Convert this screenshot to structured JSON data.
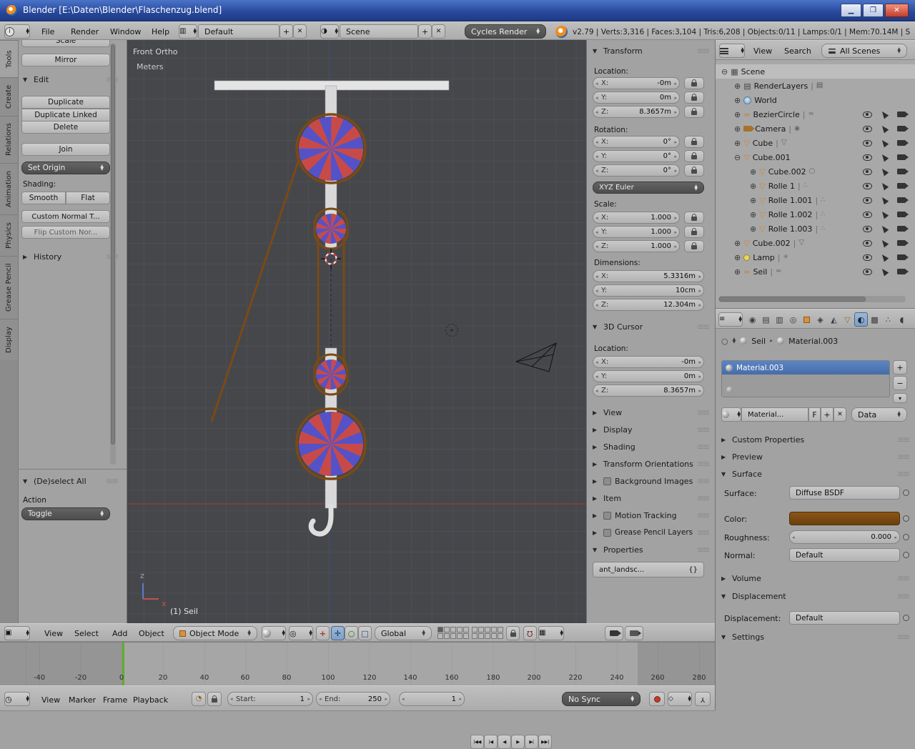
{
  "titlebar": {
    "title": "Blender [E:\\Daten\\Blender\\Flaschenzug.blend]"
  },
  "info": {
    "menus": [
      "File",
      "Render",
      "Window",
      "Help"
    ],
    "layout": "Default",
    "scene": "Scene",
    "engine": "Cycles Render",
    "stats": "v2.79 | Verts:3,316 | Faces:3,104 | Tris:6,208 | Objects:0/11 | Lamps:0/1 | Mem:70.14M | S"
  },
  "ui": {
    "plus": "+",
    "minus": "−",
    "close": "✕",
    "down": "▾"
  },
  "toolshelf": {
    "tabs": [
      "Tools",
      "Create",
      "Relations",
      "Animation",
      "Physics",
      "Grease Pencil",
      "Display"
    ],
    "scale": "Scale",
    "mirror": "Mirror",
    "edit": {
      "title": "Edit",
      "duplicate": "Duplicate",
      "duplicate_linked": "Duplicate Linked",
      "delete": "Delete",
      "join": "Join",
      "set_origin": "Set Origin",
      "shading": "Shading:",
      "smooth": "Smooth",
      "flat": "Flat",
      "custom_normal": "Custom Normal T...",
      "flip_custom": "Flip Custom Nor..."
    },
    "history": "History",
    "redo": {
      "title": "(De)select All",
      "action": "Action",
      "toggle": "Toggle"
    }
  },
  "viewport": {
    "view": "Front Ortho",
    "units": "Meters",
    "active": "(1) Seil",
    "axis_z": "z",
    "axis_x": "x"
  },
  "vp_header": {
    "menus": [
      "View",
      "Select",
      "Add",
      "Object"
    ],
    "mode": "Object Mode",
    "orientation": "Global"
  },
  "npanel": {
    "transform": "Transform",
    "location": "Location:",
    "rotation": "Rotation:",
    "scale_label": "Scale:",
    "dimensions": "Dimensions:",
    "loc": [
      {
        "a": "X:",
        "v": "-0m"
      },
      {
        "a": "Y:",
        "v": "0m"
      },
      {
        "a": "Z:",
        "v": "8.3657m"
      }
    ],
    "rot": [
      {
        "a": "X:",
        "v": "0°"
      },
      {
        "a": "Y:",
        "v": "0°"
      },
      {
        "a": "Z:",
        "v": "0°"
      }
    ],
    "euler": "XYZ Euler",
    "scl": [
      {
        "a": "X:",
        "v": "1.000"
      },
      {
        "a": "Y:",
        "v": "1.000"
      },
      {
        "a": "Z:",
        "v": "1.000"
      }
    ],
    "dim": [
      {
        "a": "X:",
        "v": "5.3316m"
      },
      {
        "a": "Y:",
        "v": "10cm"
      },
      {
        "a": "Z:",
        "v": "12.304m"
      }
    ],
    "cursor": "3D Cursor",
    "cursor_location": "Location:",
    "cur": [
      {
        "a": "X:",
        "v": "-0m"
      },
      {
        "a": "Y:",
        "v": "0m"
      },
      {
        "a": "Z:",
        "v": "8.3657m"
      }
    ],
    "collapsed": [
      "View",
      "Display",
      "Shading",
      "Transform Orientations",
      "Background Images",
      "Item",
      "Motion Tracking",
      "Grease Pencil Layers"
    ],
    "properties": "Properties",
    "prop_field": "ant_landsc...",
    "prop_value": "{}"
  },
  "outliner": {
    "menus": [
      "View",
      "Search"
    ],
    "filter": "All Scenes",
    "sep": "|",
    "rows": [
      {
        "label": "Scene"
      },
      {
        "label": "RenderLayers"
      },
      {
        "label": "World"
      },
      {
        "label": "BezierCircle"
      },
      {
        "label": "Camera"
      },
      {
        "label": "Cube"
      },
      {
        "label": "Cube.001"
      },
      {
        "label": "Cube.002"
      },
      {
        "label": "Rolle 1"
      },
      {
        "label": "Rolle 1.001"
      },
      {
        "label": "Rolle 1.002"
      },
      {
        "label": "Rolle 1.003"
      },
      {
        "label": "Cube.002"
      },
      {
        "label": "Lamp"
      },
      {
        "label": "Seil"
      }
    ]
  },
  "props": {
    "object": "Seil",
    "material": "Material.003",
    "slot_name": "Material.003",
    "db_name": "Material...",
    "fake_user": "F",
    "data": "Data",
    "custom_properties": "Custom Properties",
    "preview": "Preview",
    "surface": "Surface",
    "surface_label": "Surface:",
    "surface_value": "Diffuse BSDF",
    "color_label": "Color:",
    "roughness_label": "Roughness:",
    "roughness_value": "0.000",
    "normal_label": "Normal:",
    "normal_value": "Default",
    "volume": "Volume",
    "displacement": "Displacement",
    "displacement_label": "Displacement:",
    "displacement_value": "Default",
    "settings": "Settings"
  },
  "timeline": {
    "menus": [
      "View",
      "Marker",
      "Frame",
      "Playback"
    ],
    "ticks": [
      "-40",
      "-20",
      "0",
      "20",
      "40",
      "60",
      "80",
      "100",
      "120",
      "140",
      "160",
      "180",
      "200",
      "220",
      "240",
      "260",
      "280"
    ],
    "start_label": "Start:",
    "start": "1",
    "end_label": "End:",
    "end": "250",
    "frame": "1",
    "sync": "No Sync"
  }
}
